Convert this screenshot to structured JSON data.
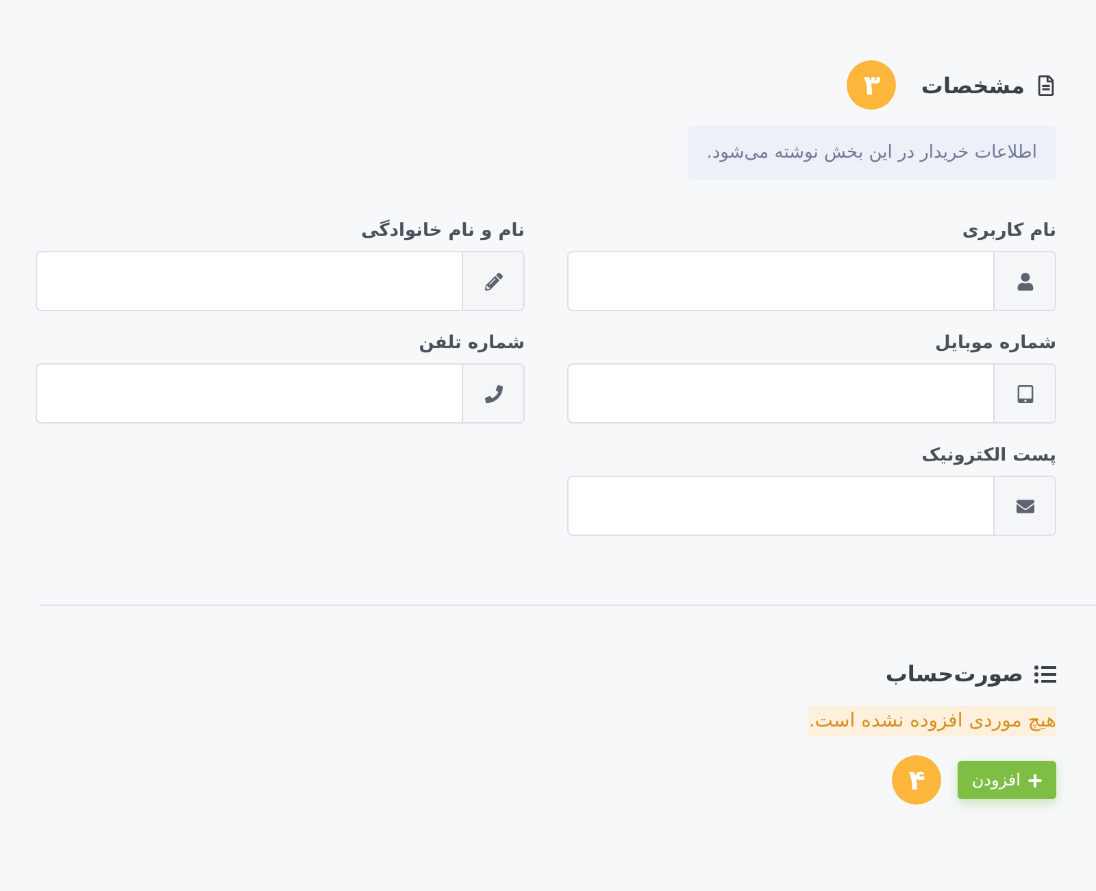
{
  "details": {
    "title": "مشخصات",
    "step": "۳",
    "note": "اطلاعات خریدار در این بخش نوشته می‌شود.",
    "fields": [
      {
        "label": "نام کاربری",
        "kind": "user"
      },
      {
        "label": "نام و نام خانوادگی",
        "kind": "pencil"
      },
      {
        "label": "شماره موبایل",
        "kind": "tablet"
      },
      {
        "label": "شماره تلفن",
        "kind": "phone"
      },
      {
        "label": "پست الکترونیک",
        "kind": "envelope"
      }
    ]
  },
  "invoice": {
    "title": "صورت‌حساب",
    "empty_message": "هیچ موردی افزوده نشده است.",
    "add_button": "افزودن",
    "step": "۴"
  }
}
